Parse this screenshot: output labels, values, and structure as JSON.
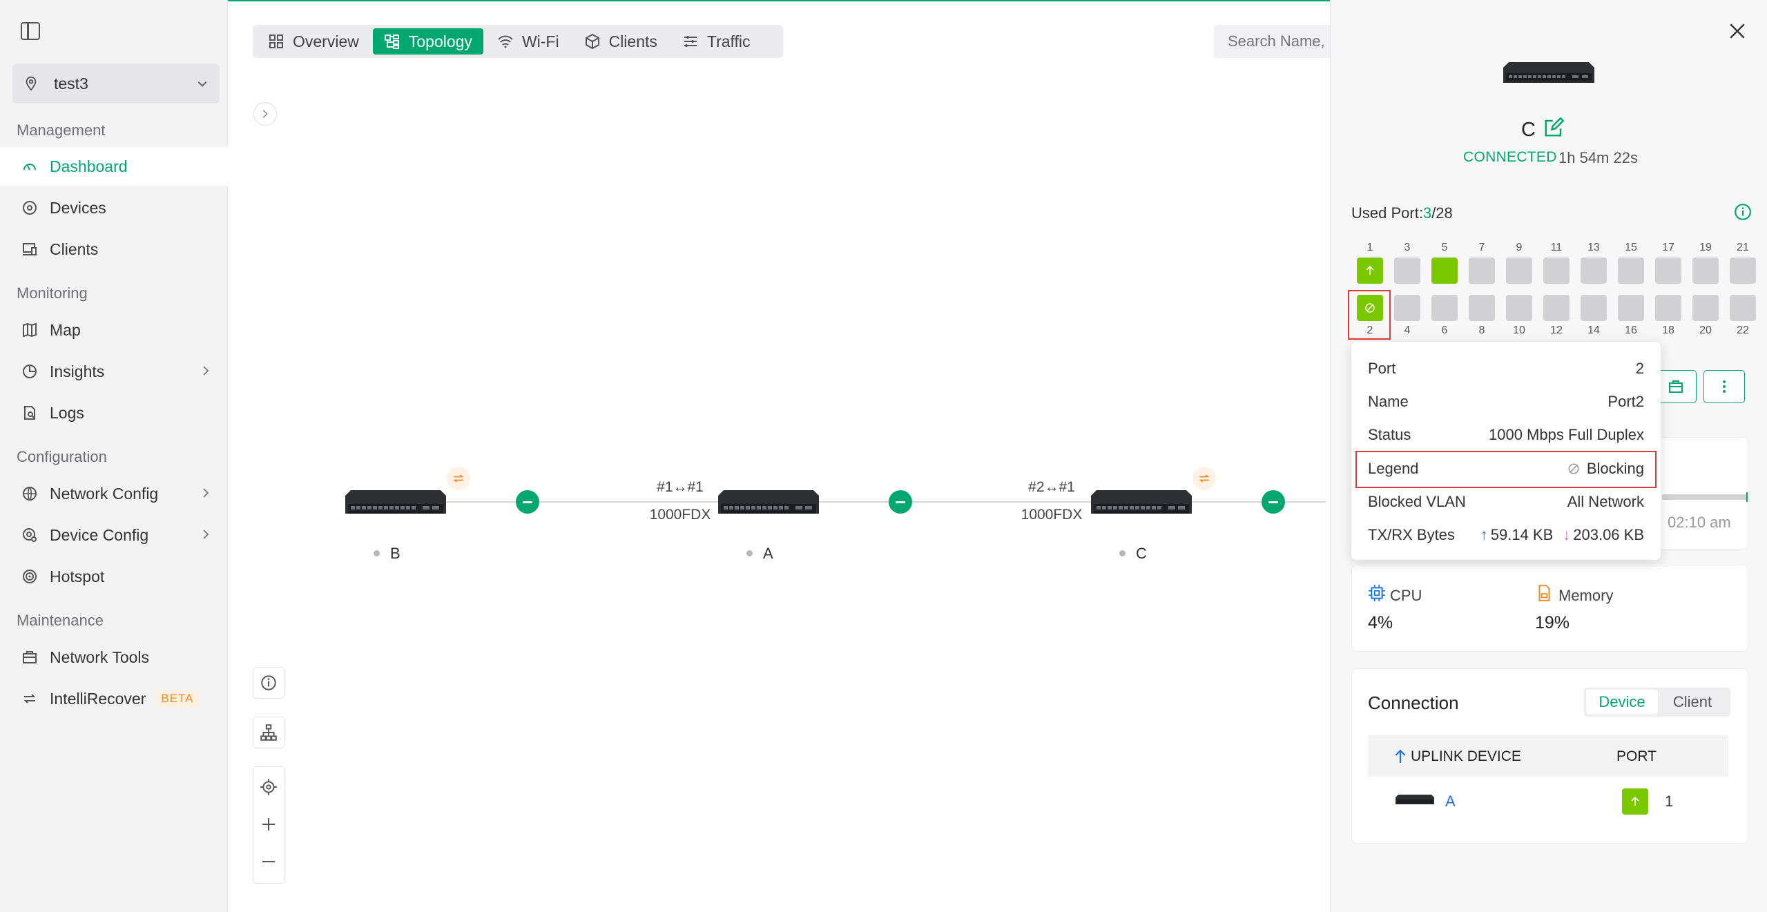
{
  "sidebar": {
    "site": "test3",
    "sections": {
      "management": "Management",
      "monitoring": "Monitoring",
      "configuration": "Configuration",
      "maintenance": "Maintenance"
    },
    "items": {
      "dashboard": "Dashboard",
      "devices": "Devices",
      "clients": "Clients",
      "map": "Map",
      "insights": "Insights",
      "logs": "Logs",
      "network_config": "Network Config",
      "device_config": "Device Config",
      "hotspot": "Hotspot",
      "network_tools": "Network Tools",
      "intellirecover": "IntelliRecover",
      "beta": "BETA"
    }
  },
  "tabs": {
    "overview": "Overview",
    "topology": "Topology",
    "wifi": "Wi-Fi",
    "clients": "Clients",
    "traffic": "Traffic"
  },
  "search": {
    "placeholder": "Search Name, IP"
  },
  "topology": {
    "nodes": {
      "b": "B",
      "a": "A",
      "c": "C"
    },
    "links": {
      "ba_ports": "#1↔#1",
      "ba_speed": "1000FDX",
      "ac_ports": "#2↔#1",
      "ac_speed": "1000FDX"
    }
  },
  "panel": {
    "device_name": "C",
    "status": "CONNECTED",
    "uptime": "1h 54m 22s",
    "used_port_label": "Used Port:",
    "used_port_count": "3",
    "used_port_total": "/28",
    "ports_top": [
      "1",
      "3",
      "5",
      "7",
      "9",
      "11",
      "13",
      "15",
      "17",
      "19",
      "21"
    ],
    "ports_bottom": [
      "2",
      "4",
      "6",
      "8",
      "10",
      "12",
      "14",
      "16",
      "18",
      "20",
      "22"
    ],
    "time_text": "02:10 am",
    "cpu_label": "CPU",
    "cpu_value": "4%",
    "memory_label": "Memory",
    "memory_value": "19%",
    "connection_title": "Connection",
    "seg_device": "Device",
    "seg_client": "Client",
    "th_uplink": "UPLINK DEVICE",
    "th_port": "PORT",
    "uplink_name": "A",
    "uplink_port": "1"
  },
  "tooltip": {
    "port_label": "Port",
    "port_value": "2",
    "name_label": "Name",
    "name_value": "Port2",
    "status_label": "Status",
    "status_value": "1000 Mbps Full Duplex",
    "legend_label": "Legend",
    "legend_value": "Blocking",
    "vlan_label": "Blocked VLAN",
    "vlan_value": "All Network",
    "bytes_label": "TX/RX Bytes",
    "tx_value": "59.14 KB",
    "rx_value": "203.06 KB"
  },
  "colors": {
    "accent": "#00a870",
    "port_up": "#7bc700",
    "highlight": "#e23a3a"
  }
}
